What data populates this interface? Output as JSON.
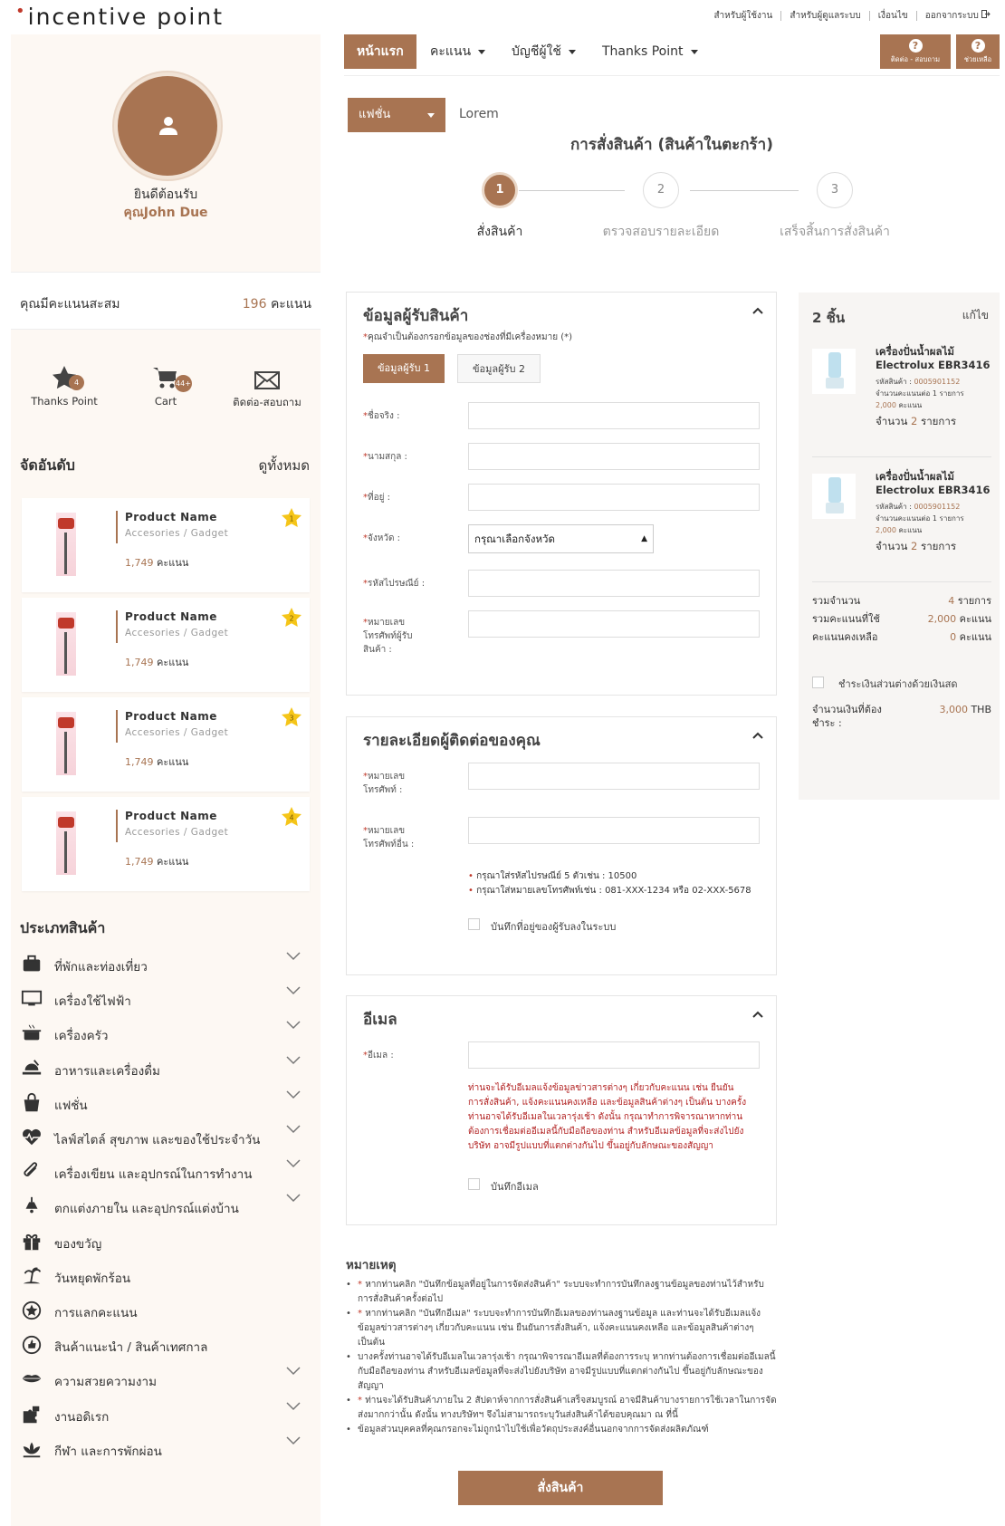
{
  "brand": {
    "logo_text": "incentive point",
    "accent": "#a87452"
  },
  "top_links": [
    "สำหรับผู้ใช้งาน",
    "สำหรับผู้ดูแลระบบ",
    "เงื่อนไข",
    "ออกจากระบบ"
  ],
  "sidebar": {
    "welcome": "ยินดีต้อนรับ",
    "user_name": "คุณJohn Due",
    "points_label": "คุณมีคะแนนสะสม",
    "points_value": "196",
    "points_unit": "คะแนน",
    "quick_links": [
      {
        "label": "Thanks Point",
        "icon": "star-icon",
        "badge": "4"
      },
      {
        "label": "Cart",
        "icon": "cart-icon",
        "badge": "44+"
      },
      {
        "label": "ติดต่อ-สอบถาม",
        "icon": "mail-icon"
      }
    ],
    "ranking_title": "จัดอันดับ",
    "see_all": "ดูทั้งหมด",
    "ranking": [
      {
        "name": "Product Name",
        "category": "Accesories / Gadget",
        "points": "1,749",
        "unit": "คะแนน",
        "rank": "1"
      },
      {
        "name": "Product Name",
        "category": "Accesories / Gadget",
        "points": "1,749",
        "unit": "คะแนน",
        "rank": "2"
      },
      {
        "name": "Product Name",
        "category": "Accesories / Gadget",
        "points": "1,749",
        "unit": "คะแนน",
        "rank": "3"
      },
      {
        "name": "Product Name",
        "category": "Accesories / Gadget",
        "points": "1,749",
        "unit": "คะแนน",
        "rank": "4"
      }
    ],
    "categories_title": "ประเภทสินค้า",
    "categories": [
      {
        "label": "ที่พักและท่องเที่ยว",
        "icon": "luggage-icon",
        "chevron": true
      },
      {
        "label": "เครื่องใช้ไฟฟ้า",
        "icon": "monitor-icon",
        "chevron": true
      },
      {
        "label": "เครื่องครัว",
        "icon": "pot-icon",
        "chevron": true
      },
      {
        "label": "อาหารและเครื่องดื่ม",
        "icon": "food-icon",
        "chevron": true
      },
      {
        "label": "แฟชั่น",
        "icon": "bag-icon",
        "chevron": true
      },
      {
        "label": "ไลฟ์สไตล์ สุขภาพ และของใช้ประจำวัน",
        "icon": "heartbeat-icon",
        "chevron": true
      },
      {
        "label": "เครื่องเขียน และอุปกรณ์ในการทำงาน",
        "icon": "paperclip-icon",
        "chevron": true
      },
      {
        "label": "ตกแต่งภายใน และอุปกรณ์แต่งบ้าน",
        "icon": "lamp-icon",
        "chevron": true
      },
      {
        "label": "ของขวัญ",
        "icon": "gift-icon",
        "chevron": false
      },
      {
        "label": "วันหยุดพักร้อน",
        "icon": "island-icon",
        "chevron": false
      },
      {
        "label": "การแลกคะแนน",
        "icon": "star-badge-icon",
        "chevron": false
      },
      {
        "label": "สินค้าแนะนำ / สินค้าเทศกาล",
        "icon": "thumbs-up-icon",
        "chevron": false
      },
      {
        "label": "ความสวยความงาม",
        "icon": "lips-icon",
        "chevron": true
      },
      {
        "label": "งานอดิเรก",
        "icon": "puzzle-icon",
        "chevron": true
      },
      {
        "label": "กีฬา และการพักผ่อน",
        "icon": "lotus-icon",
        "chevron": true
      }
    ]
  },
  "nav": {
    "home": "หน้าแรก",
    "items": [
      "คะแนน",
      "บัญชีผู้ใช้",
      "Thanks Point"
    ],
    "help1": "ติดต่อ - สอบถาม",
    "help2": "ช่วยเหลือ"
  },
  "category_select": "แฟชั่น",
  "lorem": "Lorem",
  "page_title": "การสั่งสินค้า (สินค้าในตะกร้า)",
  "steps": [
    {
      "num": "1",
      "label": "สั่งสินค้า"
    },
    {
      "num": "2",
      "label": "ตรวจสอบรายละเอียด"
    },
    {
      "num": "3",
      "label": "เสร็จสิ้นการสั่งสินค้า"
    }
  ],
  "recipient": {
    "title": "ข้อมูลผู้รับสินค้า",
    "required_note": "คุณจำเป็นต้องกรอกข้อมูลของช่องที่มีเครื่องหมาย (*)",
    "tab1": "ข้อมูลผู้รับ 1",
    "tab2": "ข้อมูลผู้รับ 2",
    "fields": {
      "first_name": "ชื่อจริง :",
      "last_name": "นามสกุล :",
      "address": "ที่อยู่ :",
      "province": "จังหวัด :",
      "zipcode": "รหัสไปรษณีย์ :",
      "phone_l1": "หมายเลข",
      "phone_l2": "โทรศัพท์ผู้รับ",
      "phone_l3": "สินค้า :"
    },
    "province_placeholder": "กรุณาเลือกจังหวัด"
  },
  "contact": {
    "title": "รายละเอียดผู้ติดต่อของคุณ",
    "phone_l1": "หมายเลข",
    "phone_l2": "โทรศัพท์ :",
    "other_l1": "หมายเลข",
    "other_l2": "โทรศัพท์อื่น :",
    "note1": "กรุณาใส่รหัสไปรษณีย์ 5 ตัวเช่น : 10500",
    "note2": "กรุณาใส่หมายเลขโทรศัพท์เช่น : 081-XXX-1234 หรือ 02-XXX-5678",
    "save_label": "บันทึกที่อยู่ของผู้รับลงในระบบ"
  },
  "email": {
    "title": "อีเมล",
    "field": "อีเมล :",
    "notice": "ท่านจะได้รับอีเมลแจ้งข้อมูลข่าวสารต่างๆ เกี่ยวกับคะแนน เช่น ยืนยันการสั่งสินค้า, แจ้งคะแนนคงเหลือ และข้อมูลสินค้าต่างๆ เป็นต้น บางครั้งท่านอาจได้รับอีเมลในเวลารุ่งเช้า ดังนั้น กรุณาทำการพิจารณาหากท่านต้องการเชื่อมต่ออีเมลนี้กับมือถือของท่าน สำหรับอีเมลข้อมูลที่จะส่งไปยังบริษัท อาจมีรูปแบบที่แตกต่างกันไป ขึ้นอยู่กับลักษณะของสัญญา",
    "save_label": "บันทึกอีเมล"
  },
  "remarks": {
    "title": "หมายเหตุ",
    "items": [
      {
        "mark": "*",
        "text": "หากท่านคลิก \"บันทึกข้อมูลที่อยู่ในการจัดส่งสินค้า\" ระบบจะทำการบันทึกลงฐานข้อมูลของท่านไว้สำหรับการสั่งสินค้าครั้งต่อไป"
      },
      {
        "mark": "*",
        "text": "หากท่านคลิก \"บันทึกอีเมล\" ระบบจะทำการบันทึกอีเมลของท่านลงฐานข้อมูล และท่านจะได้รับอีเมลแจ้งข้อมูลข่าวสารต่างๆ เกี่ยวกับคะแนน เช่น ยืนยันการสั่งสินค้า, แจ้งคะแนนคงเหลือ และข้อมูลสินค้าต่างๆ เป็นต้น"
      },
      {
        "mark": "",
        "text": "บางครั้งท่านอาจได้รับอีเมลในเวลารุ่งเช้า กรุณาพิจารณาอีเมลที่ต้องการระบุ หากท่านต้องการเชื่อมต่ออีเมลนี้กับมือถือของท่าน สำหรับอีเมลข้อมูลที่จะส่งไปยังบริษัท อาจมีรูปแบบที่แตกต่างกันไป ขึ้นอยู่กับลักษณะของสัญญา"
      },
      {
        "mark": "*",
        "text": "ท่านจะได้รับสินค้าภายใน 2 สัปดาห์จากการสั่งสินค้าเสร็จสมบูรณ์ อาจมีสินค้าบางรายการใช้เวลาในการจัดส่งมากกว่านั้น ดังนั้น ทางบริษัทฯ จึงไม่สามารถระบุวันส่งสินค้าได้ขอบคุณมา ณ ที่นี้"
      },
      {
        "mark": "",
        "text": "ข้อมูลส่วนบุคคลที่คุณกรอกจะไม่ถูกนำไปใช้เพื่อวัตถุประสงค์อื่นนอกจากการจัดส่งผลิตภัณฑ์"
      }
    ]
  },
  "order_button": "สั่งสินค้า",
  "cart": {
    "count": "2 ชิ้น",
    "edit": "แก้ไข",
    "items": [
      {
        "name1": "เครื่องปั่นน้ำผลไม้",
        "name2": "Electrolux EBR3416",
        "code_label": "รหัสสินค้า :",
        "code": "0005901152",
        "per_label": "จำนวนคะแนนต่อ 1 รายการ",
        "points": "2,000",
        "points_unit": "คะแนน",
        "qty_label": "จำนวน",
        "qty": "2",
        "qty_unit": "รายการ"
      },
      {
        "name1": "เครื่องปั่นน้ำผลไม้",
        "name2": "Electrolux EBR3416",
        "code_label": "รหัสสินค้า :",
        "code": "0005901152",
        "per_label": "จำนวนคะแนนต่อ 1 รายการ",
        "points": "2,000",
        "points_unit": "คะแนน",
        "qty_label": "จำนวน",
        "qty": "2",
        "qty_unit": "รายการ"
      }
    ],
    "summary": [
      {
        "label": "รวมจำนวน",
        "value": "4",
        "unit": "รายการ"
      },
      {
        "label": "รวมคะแนนที่ใช้",
        "value": "2,000",
        "unit": "คะแนน"
      },
      {
        "label": "คะแนนคงเหลือ",
        "value": "0",
        "unit": "คะแนน"
      }
    ],
    "pay_cash": "ชำระเงินส่วนต่างด้วยเงินสด",
    "pay_l1": "จำนวนเงินที่ต้อง",
    "pay_l2": "ชำระ :",
    "pay_amount": "3,000",
    "pay_currency": "THB"
  }
}
